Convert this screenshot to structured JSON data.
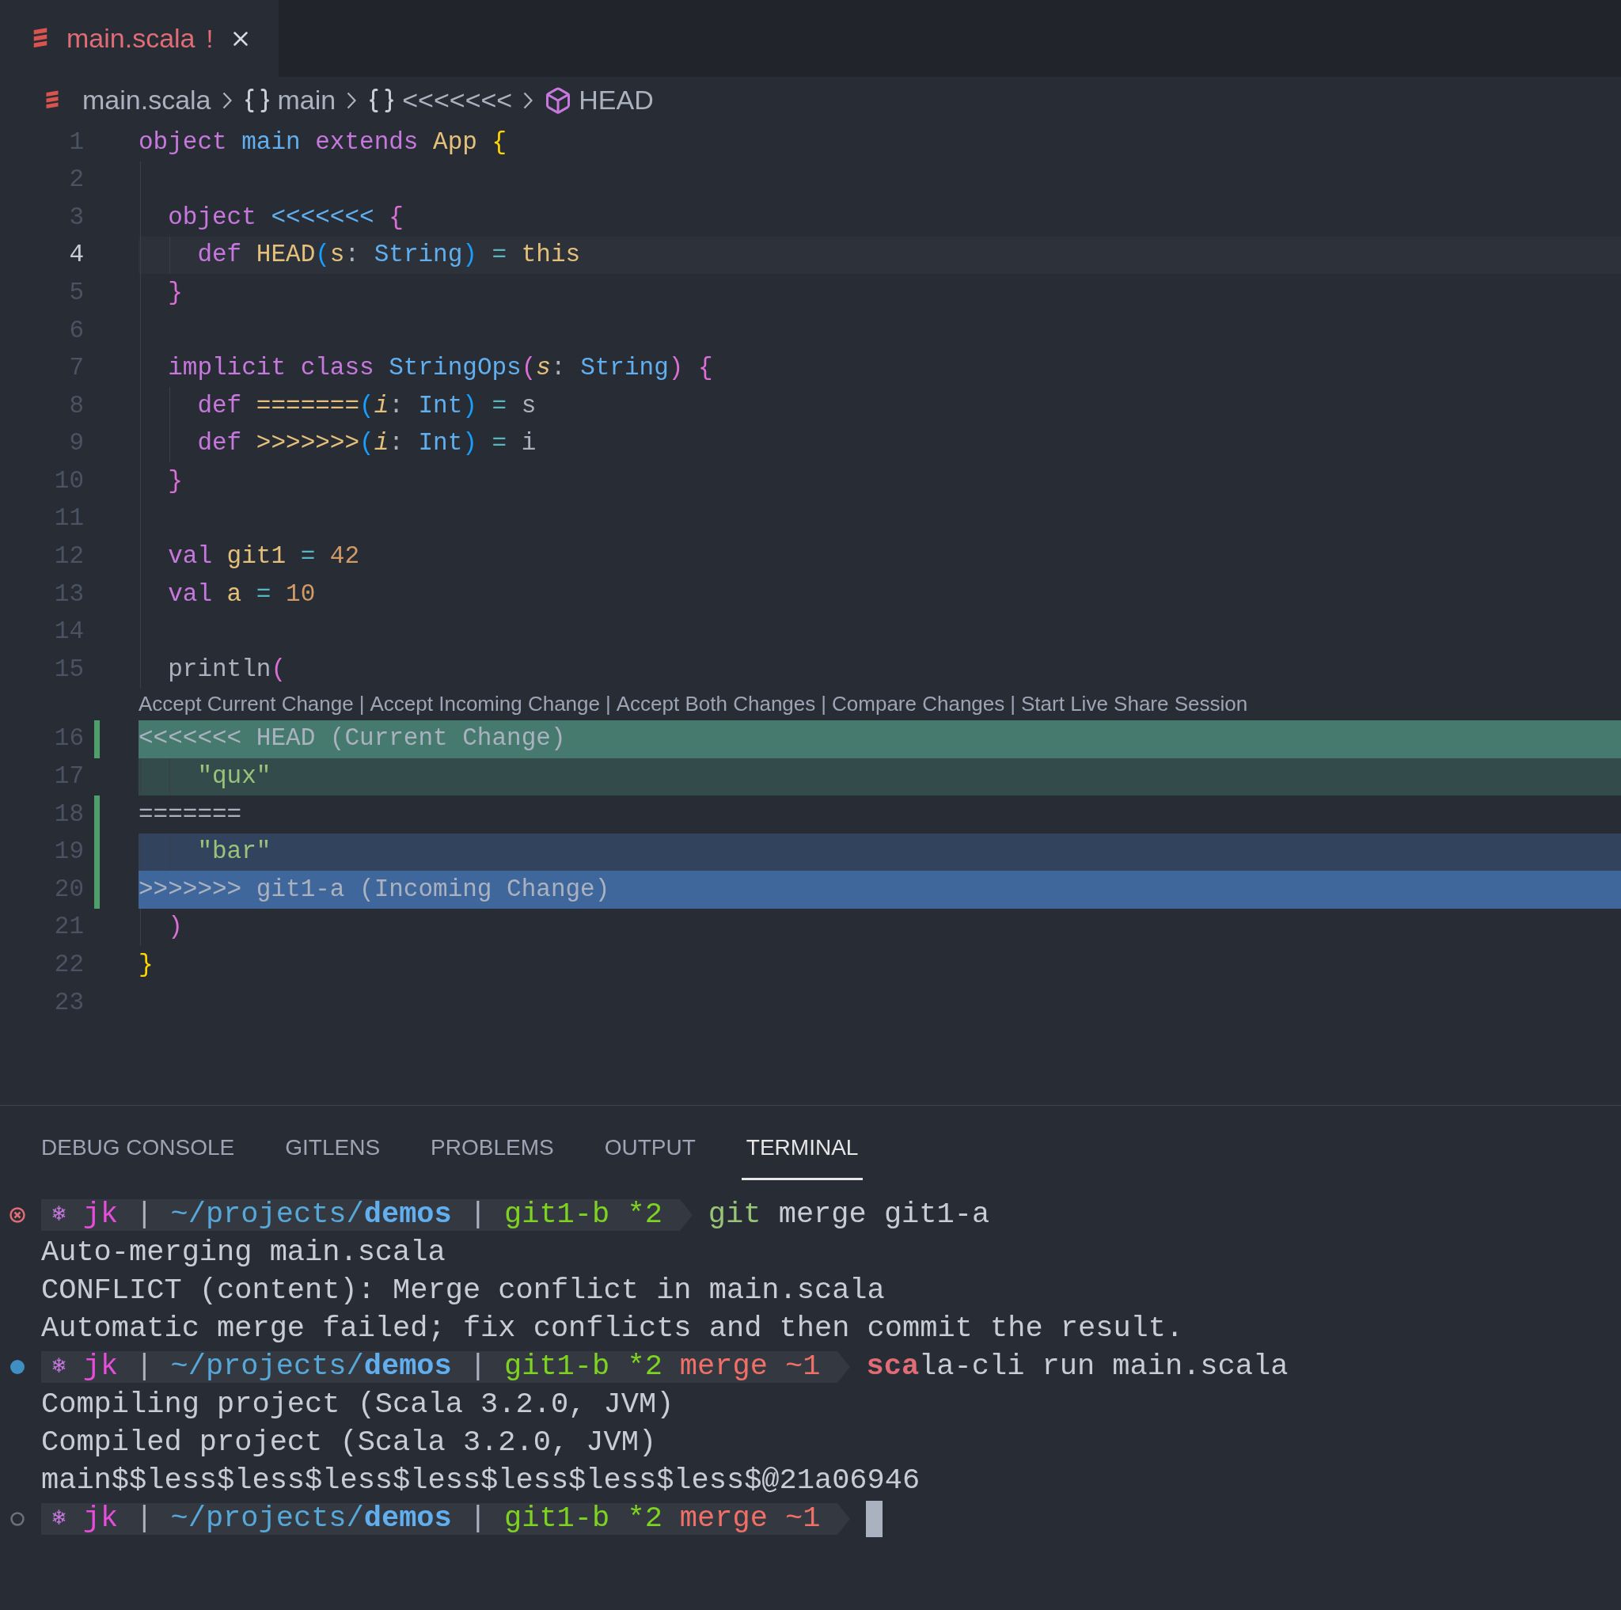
{
  "tabs": [
    {
      "label": "main.scala",
      "badge": "!",
      "selected": true
    }
  ],
  "breadcrumbs": [
    {
      "kind": "file",
      "label": "main.scala"
    },
    {
      "kind": "namespace",
      "label": "main"
    },
    {
      "kind": "namespace",
      "label": "<<<<<<<"
    },
    {
      "kind": "class",
      "label": "HEAD"
    }
  ],
  "editor": {
    "lines": [
      {
        "number": "1",
        "selected": false,
        "tokens": [
          {
            "text": "object",
            "kind": "keyword"
          },
          {
            "text": " main",
            "kind": "entity"
          },
          {
            "text": " extends",
            "kind": "keyword"
          },
          {
            "text": " App",
            "kind": "type"
          },
          {
            "text": " {",
            "kind": "bracket1"
          }
        ]
      },
      {
        "number": "2",
        "selected": false
      },
      {
        "number": "3",
        "selected": false,
        "tokens": [
          {
            "text": "  object",
            "kind": "keyword"
          },
          {
            "text": " <<<<<<<",
            "kind": "entity"
          },
          {
            "text": " {",
            "kind": "bracket2"
          }
        ]
      },
      {
        "number": "4",
        "selected": true,
        "tokens": [
          {
            "text": "    def",
            "kind": "keyword"
          },
          {
            "text": " HEAD",
            "kind": "type"
          },
          {
            "text": "(",
            "kind": "bracket3"
          },
          {
            "text": "s",
            "kind": "param"
          },
          {
            "text": ": ",
            "kind": "plain"
          },
          {
            "text": "String",
            "kind": "entity"
          },
          {
            "text": ")",
            "kind": "bracket3"
          },
          {
            "text": " =",
            "kind": "operator"
          },
          {
            "text": " this",
            "kind": "type"
          }
        ]
      },
      {
        "number": "5",
        "selected": false,
        "tokens": [
          {
            "text": "  }",
            "kind": "bracket2"
          }
        ]
      },
      {
        "number": "6",
        "selected": false
      },
      {
        "number": "7",
        "selected": false,
        "tokens": [
          {
            "text": "  implicit",
            "kind": "keyword"
          },
          {
            "text": " class",
            "kind": "keyword"
          },
          {
            "text": " StringOps",
            "kind": "entity"
          },
          {
            "text": "(",
            "kind": "bracket2"
          },
          {
            "text": "s",
            "kind": "param-italic"
          },
          {
            "text": ": ",
            "kind": "plain"
          },
          {
            "text": "String",
            "kind": "entity"
          },
          {
            "text": ")",
            "kind": "bracket2"
          },
          {
            "text": " {",
            "kind": "bracket2"
          }
        ]
      },
      {
        "number": "8",
        "selected": false,
        "tokens": [
          {
            "text": "    def",
            "kind": "keyword"
          },
          {
            "text": " =======",
            "kind": "type"
          },
          {
            "text": "(",
            "kind": "bracket3"
          },
          {
            "text": "i",
            "kind": "param-italic"
          },
          {
            "text": ": ",
            "kind": "plain"
          },
          {
            "text": "Int",
            "kind": "entity"
          },
          {
            "text": ")",
            "kind": "bracket3"
          },
          {
            "text": " =",
            "kind": "operator"
          },
          {
            "text": " s",
            "kind": "plain"
          }
        ]
      },
      {
        "number": "9",
        "selected": false,
        "tokens": [
          {
            "text": "    def",
            "kind": "keyword"
          },
          {
            "text": " >>>>>>>",
            "kind": "type"
          },
          {
            "text": "(",
            "kind": "bracket3"
          },
          {
            "text": "i",
            "kind": "param-italic"
          },
          {
            "text": ": ",
            "kind": "plain"
          },
          {
            "text": "Int",
            "kind": "entity"
          },
          {
            "text": ")",
            "kind": "bracket3"
          },
          {
            "text": " =",
            "kind": "operator"
          },
          {
            "text": " i",
            "kind": "plain"
          }
        ]
      },
      {
        "number": "10",
        "selected": false,
        "tokens": [
          {
            "text": "  }",
            "kind": "bracket2"
          }
        ]
      },
      {
        "number": "11",
        "selected": false
      },
      {
        "number": "12",
        "selected": false,
        "tokens": [
          {
            "text": "  val",
            "kind": "keyword"
          },
          {
            "text": " git1",
            "kind": "type"
          },
          {
            "text": " =",
            "kind": "operator"
          },
          {
            "text": " 42",
            "kind": "number"
          }
        ]
      },
      {
        "number": "13",
        "selected": false,
        "tokens": [
          {
            "text": "  val",
            "kind": "keyword"
          },
          {
            "text": " a",
            "kind": "type"
          },
          {
            "text": " =",
            "kind": "operator"
          },
          {
            "text": " 10",
            "kind": "number"
          }
        ]
      },
      {
        "number": "14",
        "selected": false
      },
      {
        "number": "15",
        "selected": false,
        "tokens": [
          {
            "text": "  println",
            "kind": "plain"
          },
          {
            "text": "(",
            "kind": "bracket2"
          }
        ],
        "codelens": {
          "separator": "|",
          "actions": [
            "Accept Current Change",
            "Accept Incoming Change",
            "Accept Both Changes",
            "Compare Changes",
            "Start Live Share Session"
          ]
        }
      },
      {
        "number": "16",
        "selected": false,
        "kind": "current-marker",
        "gutter_mark": true,
        "tokens": [
          {
            "text": "<<<<<<< HEAD (Current Change)",
            "kind": "marker"
          }
        ]
      },
      {
        "number": "17",
        "selected": false,
        "kind": "current",
        "tokens": [
          {
            "text": "    \"qux\"",
            "kind": "string"
          }
        ]
      },
      {
        "number": "18",
        "selected": false,
        "gutter_mark": true,
        "tokens": [
          {
            "text": "=======",
            "kind": "marker"
          }
        ]
      },
      {
        "number": "19",
        "selected": false,
        "kind": "incoming",
        "gutter_mark": true,
        "tokens": [
          {
            "text": "    \"bar\"",
            "kind": "string"
          }
        ]
      },
      {
        "number": "20",
        "selected": false,
        "kind": "incoming-marker",
        "gutter_mark": true,
        "tokens": [
          {
            "text": ">>>>>>> git1-a (Incoming Change)",
            "kind": "marker"
          }
        ]
      },
      {
        "number": "21",
        "selected": false,
        "tokens": [
          {
            "text": "  )",
            "kind": "bracket2"
          }
        ]
      },
      {
        "number": "22",
        "selected": false,
        "tokens": [
          {
            "text": "}",
            "kind": "bracket1"
          }
        ]
      },
      {
        "number": "23",
        "selected": false
      }
    ]
  },
  "panel": {
    "tabs": [
      {
        "label": "DEBUG CONSOLE",
        "selected": false
      },
      {
        "label": "GITLENS",
        "selected": false
      },
      {
        "label": "PROBLEMS",
        "selected": false
      },
      {
        "label": "OUTPUT",
        "selected": false
      },
      {
        "label": "TERMINAL",
        "selected": true
      }
    ],
    "terminal": [
      {
        "kind": "prompt",
        "status_icon": {
          "kind": "error"
        },
        "symbol": "❄",
        "user": "jk",
        "separator": "|",
        "path": "~/projects/**demos**",
        "branch": "git1-b *2",
        "command": [
          {
            "text": "git",
            "kind": "valid"
          },
          {
            "text": " merge git1-a",
            "kind": "plain"
          }
        ]
      },
      {
        "kind": "output",
        "text": "Auto-merging main.scala"
      },
      {
        "kind": "output",
        "text": "CONFLICT (content): Merge conflict in main.scala"
      },
      {
        "kind": "output",
        "text": "Automatic merge failed; fix conflicts and then commit the result."
      },
      {
        "kind": "prompt",
        "status_icon": {
          "kind": "success"
        },
        "symbol": "❄",
        "user": "jk",
        "separator": "|",
        "path": "~/projects/**demos**",
        "branch": "git1-b *2",
        "state": "merge ~1",
        "command": [
          {
            "text": "sca",
            "kind": "partial"
          },
          {
            "text": "la-cli run main.scala",
            "kind": "plain"
          }
        ]
      },
      {
        "kind": "output",
        "text": "Compiling project (Scala 3.2.0, JVM)"
      },
      {
        "kind": "output",
        "text": "Compiled project (Scala 3.2.0, JVM)"
      },
      {
        "kind": "output",
        "text": "main$$less$less$less$less$less$less$less$@21a06946"
      },
      {
        "kind": "prompt",
        "status_icon": {
          "kind": "idle"
        },
        "symbol": "❄",
        "user": "jk",
        "separator": "|",
        "path": "~/projects/**demos**",
        "branch": "git1-b *2",
        "state": "merge ~1",
        "cursor": true
      }
    ]
  }
}
